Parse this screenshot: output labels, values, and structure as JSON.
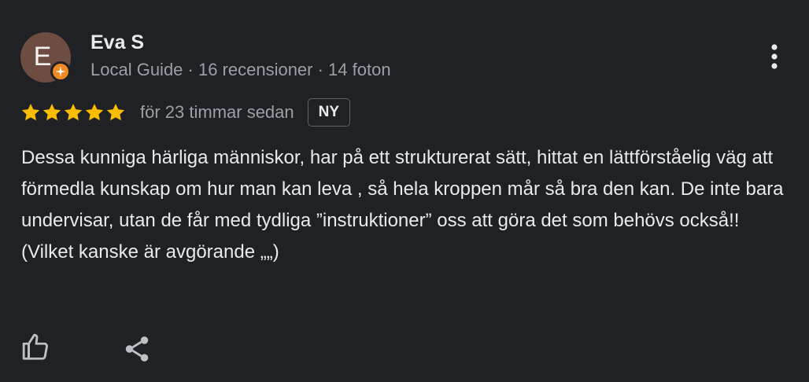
{
  "reviewer": {
    "initial": "E",
    "avatar_color": "#6d4c41",
    "badge_color": "#f08a24",
    "badge_icon": "local-guide-star-icon",
    "name": "Eva S",
    "meta": "Local Guide · 16 recensioner · 14 foton"
  },
  "review": {
    "rating": 5,
    "max_rating": 5,
    "star_color": "#fbbc04",
    "time": "för 23 timmar sedan",
    "new_badge": "NY",
    "text": "Dessa kunniga härliga människor, har på ett strukturerat sätt, hittat en lättförståelig väg att förmedla kunskap om hur man kan leva , så hela kroppen mår så bra den kan. De inte bara undervisar, utan de får med tydliga ”instruktioner” oss att göra det som behövs också!! (Vilket kanske är avgörande „„)"
  },
  "actions": {
    "like_icon": "thumbs-up-icon",
    "share_icon": "share-icon",
    "more_icon": "more-vertical-icon"
  }
}
